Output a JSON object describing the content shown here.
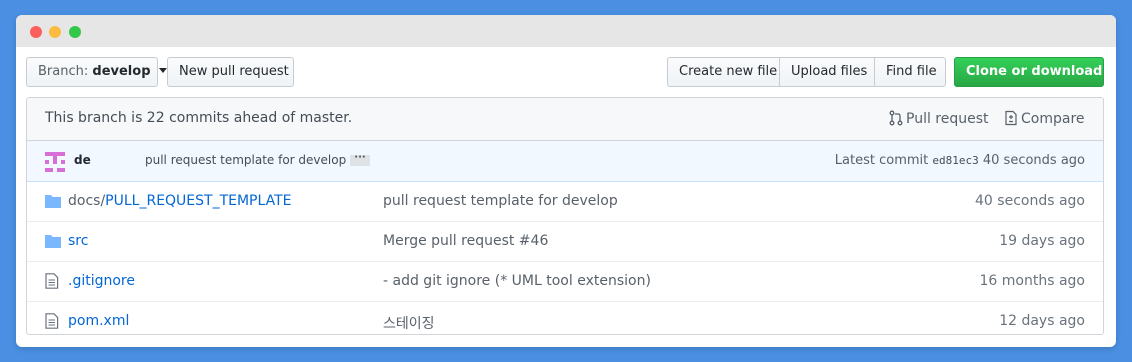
{
  "toolbar": {
    "branch_prefix": "Branch:",
    "branch_name": "develop",
    "new_pr_label": "New pull request",
    "create_file_label": "Create new file",
    "upload_files_label": "Upload files",
    "find_file_label": "Find file",
    "clone_label": "Clone or download"
  },
  "branch_info": {
    "message": "This branch is 22 commits ahead of master.",
    "pull_request_label": "Pull request",
    "compare_label": "Compare"
  },
  "latest_commit": {
    "author": "de",
    "message": "pull request template for develop",
    "ellipsis": "···",
    "latest_prefix": "Latest commit",
    "sha": "ed81ec3",
    "age": "40 seconds ago"
  },
  "files": [
    {
      "type": "folder",
      "path": "docs/",
      "name": "PULL_REQUEST_TEMPLATE",
      "message": "pull request template for develop",
      "age": "40 seconds ago"
    },
    {
      "type": "folder",
      "path": "",
      "name": "src",
      "message": "Merge pull request #46",
      "age": "19 days ago"
    },
    {
      "type": "file",
      "path": "",
      "name": ".gitignore",
      "message": "- add git ignore (* UML tool extension)",
      "age": "16 months ago"
    },
    {
      "type": "file",
      "path": "",
      "name": "pom.xml",
      "message": "스테이징",
      "age": "12 days ago"
    }
  ],
  "colors": {
    "background": "#4a8fe2",
    "link": "#0366d6",
    "green_button": "#2cbe4e",
    "commit_bar": "#f1f8ff"
  }
}
